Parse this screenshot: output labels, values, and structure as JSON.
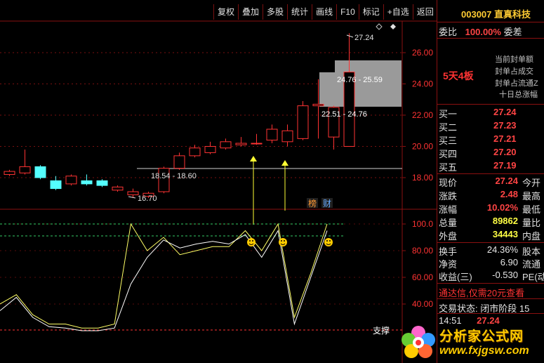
{
  "toolbar": {
    "buttons": [
      "复权",
      "叠加",
      "多股",
      "统计",
      "画线",
      "F10",
      "标记",
      "+自选",
      "返回"
    ]
  },
  "chart": {
    "price_ticks": [
      "26.00",
      "24.00",
      "22.00",
      "20.00",
      "18.00"
    ],
    "indicator_ticks": [
      "100.0",
      "80.00",
      "60.00",
      "40.00"
    ],
    "ann_high": "27.24",
    "ann_low": "16.70",
    "ann_range1": "24.76 - 25.59",
    "ann_range2": "22.51 - 24.76",
    "ann_range3": "18.54 - 18.60",
    "badge_bang": "榜",
    "badge_cai": "财",
    "support_label": "支撑"
  },
  "quote": {
    "code": "003007",
    "name": "直真科技",
    "weibi_label": "委比",
    "weibi_value": "100.00%",
    "weicha_label": "委差",
    "seal1": "当前封单额",
    "seal2": "封单占成交",
    "seal3": "封单占流通Z",
    "seal4": "十日总涨幅",
    "board_label": "5天4板",
    "bids": [
      {
        "label": "买一",
        "price": "27.24"
      },
      {
        "label": "买二",
        "price": "27.23"
      },
      {
        "label": "买三",
        "price": "27.21"
      },
      {
        "label": "买四",
        "price": "27.20"
      },
      {
        "label": "买五",
        "price": "27.19"
      }
    ],
    "stats": [
      {
        "label": "现价",
        "value": "27.24",
        "label2": "今开"
      },
      {
        "label": "涨跌",
        "value": "2.48",
        "label2": "最高"
      },
      {
        "label": "涨幅",
        "value": "10.02%",
        "label2": "最低"
      },
      {
        "label": "总量",
        "value": "89862",
        "label2": "量比"
      },
      {
        "label": "外盘",
        "value": "34443",
        "label2": "内盘"
      }
    ],
    "stats2": [
      {
        "label": "换手",
        "value": "24.36%",
        "label2": "股本"
      },
      {
        "label": "净资",
        "value": "6.90",
        "label2": "流通"
      },
      {
        "label": "收益(三)",
        "value": "-0.530",
        "label2": "PE(动"
      }
    ],
    "ad_text": "通达信,仅需20元查看",
    "trade_status": "交易状态: 闭市阶段 15",
    "last_time": "14:51",
    "last_price": "27.24"
  },
  "logo": {
    "title": "分析家公式网",
    "url": "www.fxjgsw.com"
  },
  "chart_data": [
    {
      "type": "candlestick",
      "title": "",
      "ylim": [
        16.0,
        28.0
      ],
      "x": [
        1,
        2,
        3,
        4,
        5,
        6,
        7,
        8,
        9,
        10,
        11,
        12,
        13,
        14,
        15,
        16,
        17,
        18,
        19,
        20,
        21,
        22,
        23
      ],
      "series": [
        {
          "open": [
            18.2,
            18.3,
            18.7,
            17.8,
            17.6,
            17.8,
            17.8,
            17.2,
            16.9,
            16.8,
            17.1,
            18.6,
            19.4,
            19.6,
            19.9,
            20.1,
            20.2,
            20.4,
            20.3,
            20.5,
            22.6,
            20.6,
            20.0
          ],
          "close": [
            18.4,
            18.7,
            18.0,
            17.3,
            18.1,
            17.6,
            17.5,
            17.4,
            17.1,
            17.0,
            18.6,
            19.4,
            19.9,
            20.0,
            20.3,
            20.2,
            20.2,
            21.1,
            21.0,
            22.6,
            22.7,
            22.5,
            24.76
          ],
          "high": [
            18.5,
            19.8,
            18.8,
            18.1,
            18.2,
            18.2,
            17.9,
            17.5,
            17.3,
            17.1,
            18.7,
            19.6,
            20.1,
            20.3,
            20.5,
            20.6,
            20.8,
            21.4,
            21.4,
            22.9,
            24.3,
            22.6,
            27.24
          ],
          "low": [
            18.1,
            18.2,
            17.9,
            17.2,
            17.5,
            17.5,
            17.4,
            17.1,
            16.7,
            16.7,
            17.0,
            18.5,
            19.3,
            19.5,
            19.8,
            20.0,
            20.1,
            20.2,
            20.0,
            20.4,
            20.5,
            19.8,
            24.76
          ]
        }
      ]
    },
    {
      "type": "line",
      "title": "",
      "ylim": [
        20,
        100
      ],
      "series": [
        {
          "name": "",
          "values": [
            40,
            47,
            32,
            25,
            25,
            22,
            22,
            25,
            100,
            80,
            90,
            77,
            80,
            83,
            83,
            95,
            80,
            100,
            30,
            63,
            100
          ]
        },
        {
          "name": "",
          "values": [
            35,
            45,
            30,
            23,
            22,
            20,
            20,
            22,
            55,
            75,
            88,
            82,
            85,
            87,
            85,
            92,
            75,
            95,
            25,
            60,
            95
          ]
        }
      ]
    }
  ]
}
